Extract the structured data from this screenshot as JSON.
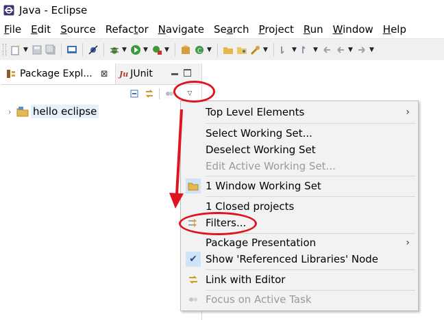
{
  "window": {
    "title": "Java - Eclipse"
  },
  "menubar": {
    "items": [
      {
        "mnemonic": "F",
        "rest": "ile"
      },
      {
        "mnemonic": "E",
        "rest": "dit"
      },
      {
        "mnemonic": "S",
        "rest": "ource"
      },
      {
        "pre": "Refac",
        "mnemonic": "t",
        "rest": "or"
      },
      {
        "mnemonic": "N",
        "rest": "avigate"
      },
      {
        "pre": "Se",
        "mnemonic": "a",
        "rest": "rch"
      },
      {
        "mnemonic": "P",
        "rest": "roject"
      },
      {
        "mnemonic": "R",
        "rest": "un"
      },
      {
        "mnemonic": "W",
        "rest": "indow"
      },
      {
        "mnemonic": "H",
        "rest": "elp"
      }
    ]
  },
  "package_explorer": {
    "tab_label": "Package Expl...",
    "tab_close": "⊠",
    "junit_tab_label": "JUnit",
    "junit_icon_text": "Ju",
    "tree": [
      {
        "label": "hello eclipse",
        "icon": "java-project-icon",
        "expanded": false
      }
    ]
  },
  "context_menu": {
    "items": [
      {
        "label": "Top Level Elements",
        "submenu": true
      },
      {
        "label": "Select Working Set..."
      },
      {
        "label": "Deselect Working Set"
      },
      {
        "label": "Edit Active Working Set...",
        "disabled": true
      },
      {
        "label": "1 Window Working Set",
        "icon": "working-set-icon"
      },
      {
        "label": "1 Closed projects"
      },
      {
        "label": "Filters...",
        "icon": "filter-icon"
      },
      {
        "label": "Package Presentation",
        "submenu": true
      },
      {
        "label": "Show 'Referenced Libraries' Node",
        "checked": true
      },
      {
        "label": "Link with Editor",
        "icon": "link-with-editor-icon"
      },
      {
        "label": "Focus on Active Task",
        "disabled": true,
        "icon": "focus-task-icon"
      }
    ],
    "submenu_glyph": "›",
    "check_glyph": "✔"
  },
  "colors": {
    "annotation_red": "#e0141e",
    "selection_blue": "#e6f0fb",
    "menu_bg": "#f2f2f2"
  }
}
